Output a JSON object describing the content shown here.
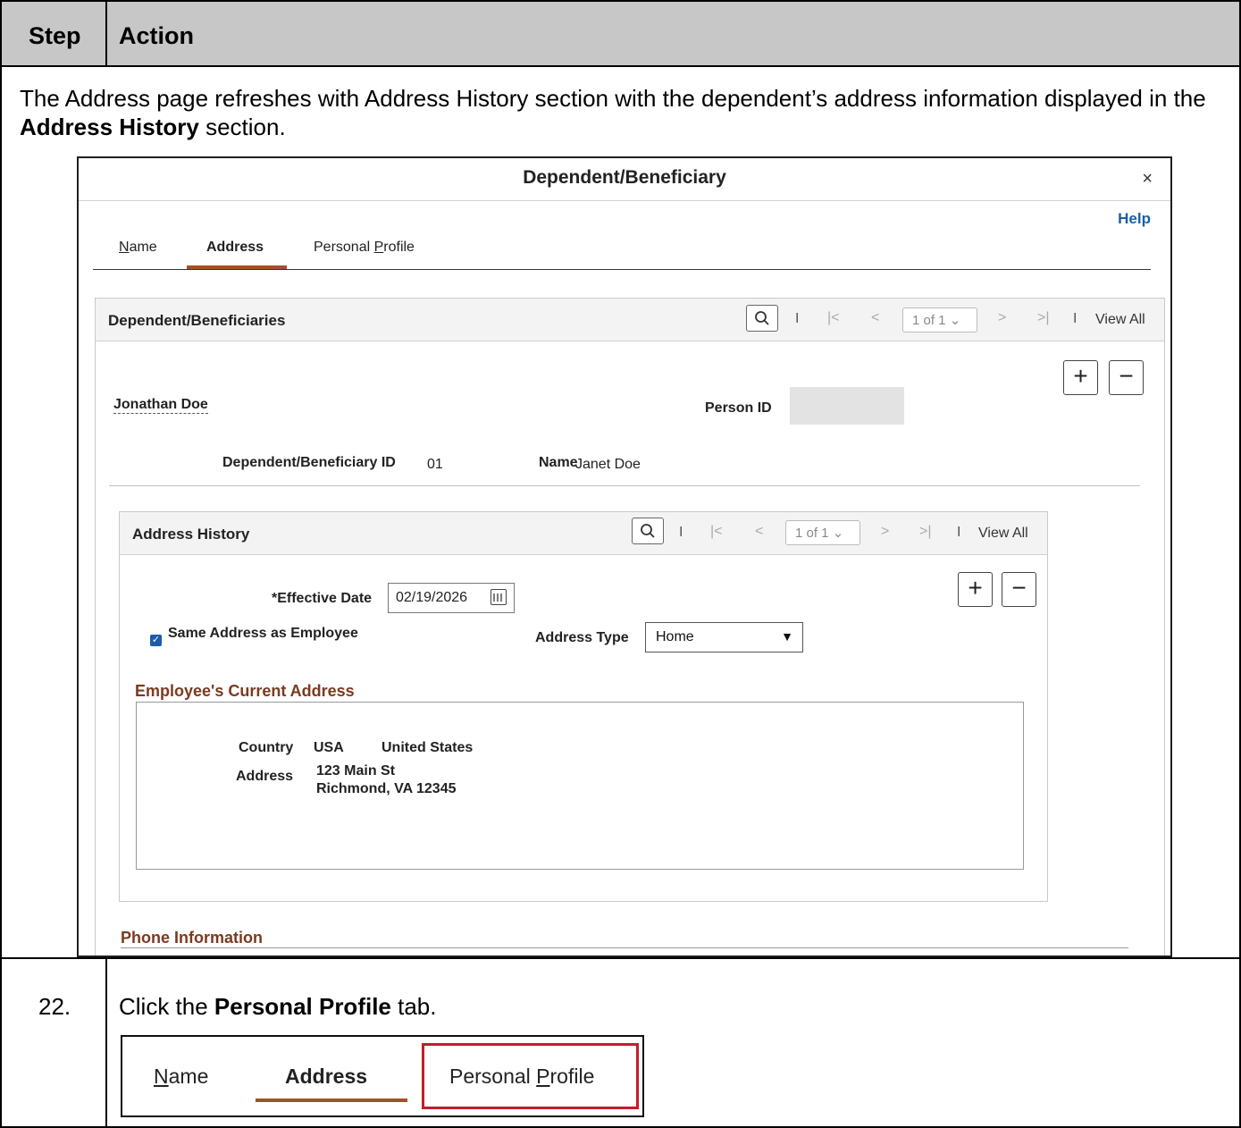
{
  "header": {
    "step": "Step",
    "action": "Action"
  },
  "intro": {
    "part1": "The Address page refreshes with Address History section with the dependent’s address information displayed in the ",
    "bold": "Address History",
    "part2": " section."
  },
  "modal": {
    "title": "Dependent/Beneficiary",
    "close": "×",
    "help": "Help",
    "tabs": [
      {
        "pre": "",
        "ul": "N",
        "post": "ame"
      },
      {
        "label": "Address"
      },
      {
        "pre": "Personal ",
        "ul": "P",
        "post": "rofile"
      }
    ]
  },
  "dependents": {
    "title": "Dependent/Beneficiaries",
    "page": "1 of 1",
    "view_all": "View All",
    "employee_name": "Jonathan Doe",
    "person_id_label": "Person ID",
    "dep_id_label": "Dependent/Beneficiary ID",
    "dep_id_value": "01",
    "name_label": "Name",
    "name_value": "Janet Doe"
  },
  "address_history": {
    "title": "Address History",
    "page": "1 of 1",
    "view_all": "View All",
    "effective_date_label": "*Effective Date",
    "effective_date": "02/19/2026",
    "same_address_label": "Same Address as Employee",
    "address_type_label": "Address Type",
    "address_type": "Home",
    "current_address_title": "Employee's Current Address",
    "country_label": "Country",
    "country_code": "USA",
    "country_name": "United States",
    "address_label": "Address",
    "address_line1": "123 Main St",
    "address_line2": "Richmond, VA 12345"
  },
  "phone_section": "Phone Information",
  "step22": {
    "number": "22.",
    "text_pre": "Click the ",
    "text_bold": "Personal Profile",
    "text_post": " tab.",
    "tabs": [
      {
        "pre": "",
        "ul": "N",
        "post": "ame"
      },
      {
        "label": "Address"
      },
      {
        "pre": "Personal ",
        "ul": "P",
        "post": "rofile"
      }
    ]
  },
  "colors": {
    "header_bg": "#c7c7c7",
    "tab_underline": "#a0522d",
    "section_title": "#7a3a1f",
    "highlight": "#c41c2c",
    "help_link": "#1a5fa5"
  }
}
